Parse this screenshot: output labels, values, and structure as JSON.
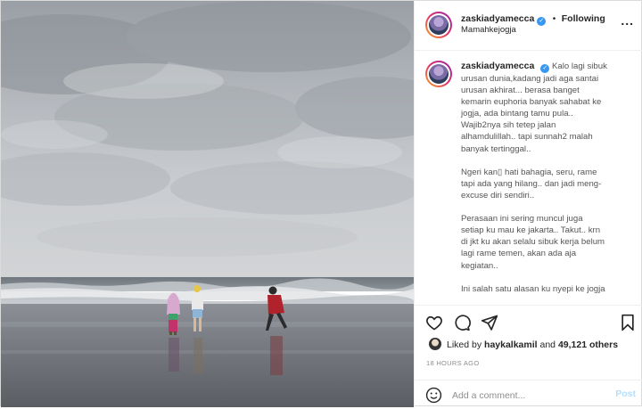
{
  "post": {
    "username": "zaskiadyamecca",
    "following_label": "Following",
    "separator": "•",
    "location": "Mamahkejogja",
    "more_label": "...",
    "caption_lines": [
      "Kalo lagi sibuk",
      "urusan dunia,kadang jadi aga santai",
      "urusan akhirat... berasa banget",
      "kemarin euphoria banyak sahabat ke",
      "jogja, ada bintang tamu pula..",
      "Wajib2nya sih tetep jalan",
      "alhamdulillah.. tapi sunnah2 malah",
      "banyak tertinggal..",
      "",
      "Ngeri kan▯ hati bahagia, seru, rame",
      "tapi ada yang hilang.. dan jadi meng-",
      "excuse diri sendiri..",
      "",
      "Perasaan ini sering muncul juga",
      "setiap ku mau ke jakarta.. Takut.. krn",
      "di jkt ku akan selalu sibuk kerja belum",
      "lagi rame temen, akan ada aja",
      "kegiatan..",
      "",
      "Ini salah satu alasan ku nyepi ke jogja"
    ],
    "likes_prefix": "Liked by",
    "liked_by_user": "haykalkamil",
    "likes_and": "and",
    "likes_count": "49,121 others",
    "timestamp": "18 HOURS AGO",
    "comment_placeholder": "Add a comment...",
    "post_button": "Post"
  },
  "icons": {
    "like": "heart-icon",
    "comment": "comment-icon",
    "share": "paper-plane-icon",
    "save": "bookmark-icon",
    "emoji": "smiley-icon",
    "verified": "verified-badge-icon"
  },
  "colors": {
    "verified": "#3897f0",
    "post_button_disabled": "#b2dffc",
    "muted": "#8e8e8e",
    "text": "#262626"
  }
}
